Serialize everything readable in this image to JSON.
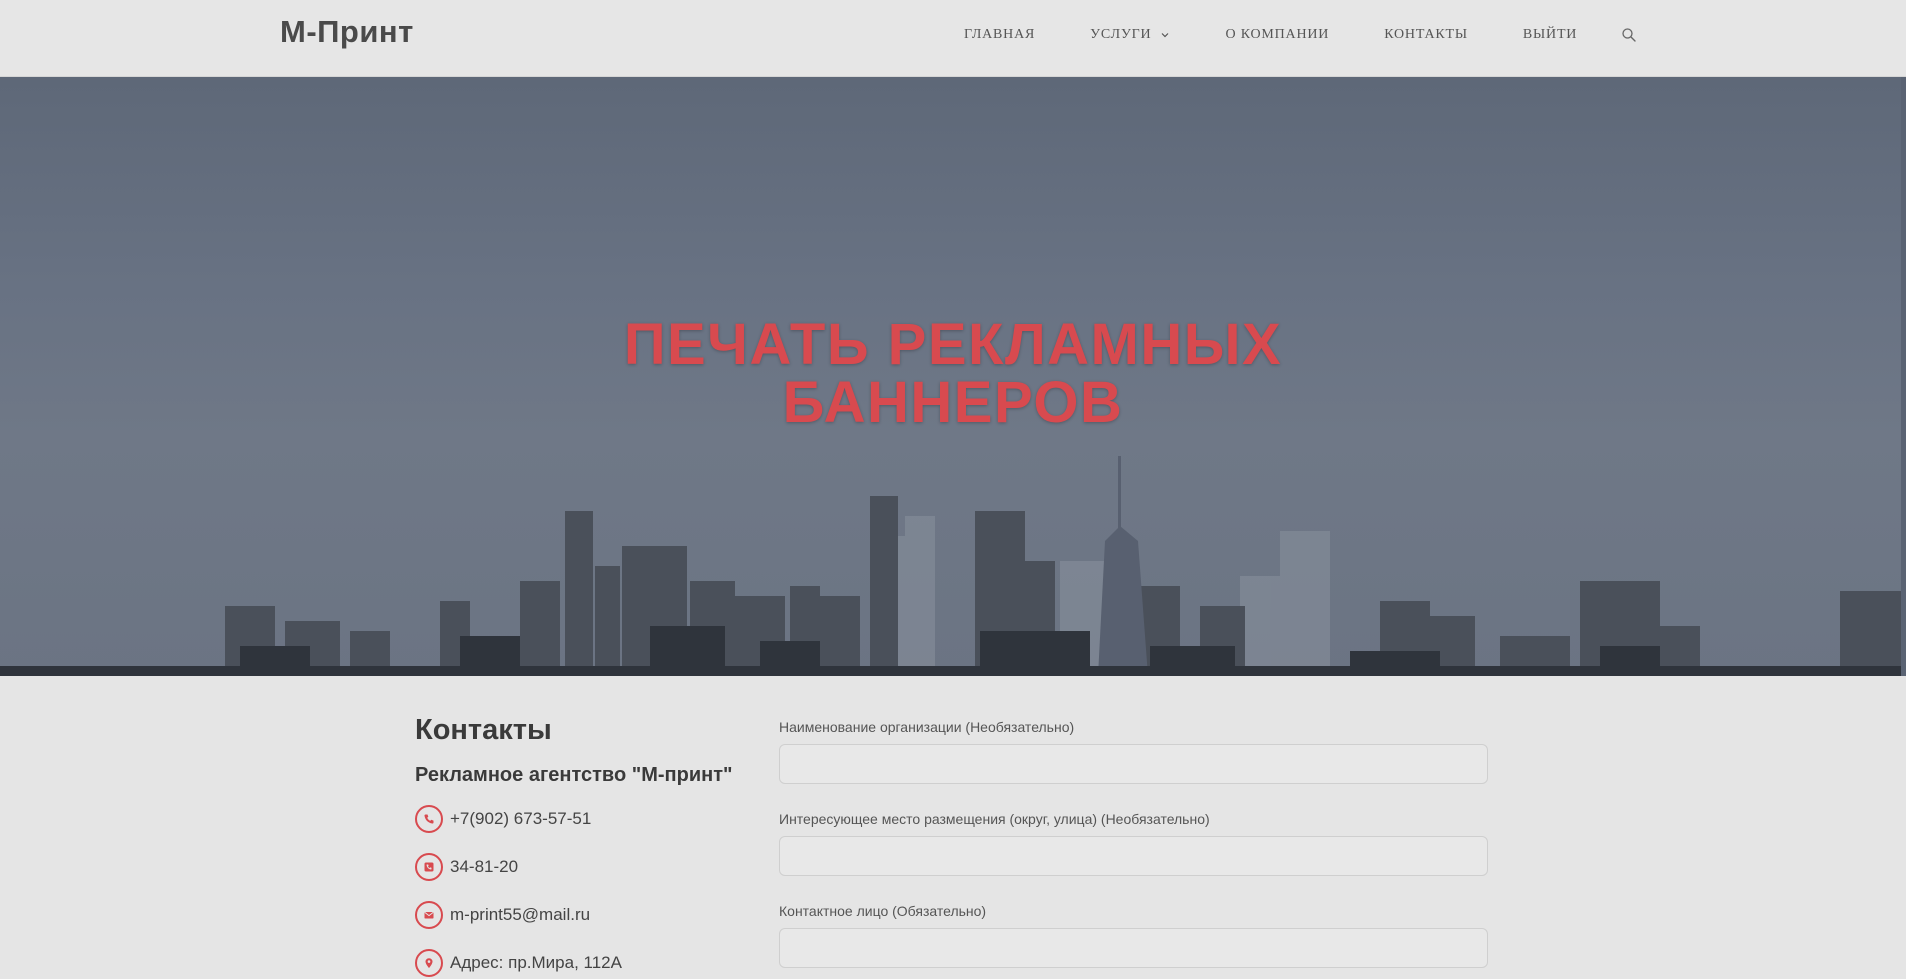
{
  "header": {
    "logo": "М-Принт",
    "nav": [
      {
        "label": "ГЛАВНАЯ"
      },
      {
        "label": "УСЛУГИ",
        "has_dropdown": true
      },
      {
        "label": "О КОМПАНИИ"
      },
      {
        "label": "КОНТАКТЫ"
      },
      {
        "label": "ВЫЙТИ"
      }
    ],
    "search_icon": "search-icon"
  },
  "hero": {
    "title_line1": "ПЕЧАТЬ РЕКЛАМНЫХ",
    "title_line2": "БАННЕРОВ",
    "title_color": "#d84a4f"
  },
  "contacts": {
    "heading": "Контакты",
    "company": "Рекламное агентство \"М-принт\"",
    "items": [
      {
        "icon": "phone-icon",
        "text": "+7(902) 673-57-51"
      },
      {
        "icon": "fax-icon",
        "text": "34-81-20"
      },
      {
        "icon": "envelope-icon",
        "text": "m-print55@mail.ru"
      },
      {
        "icon": "location-pin-icon",
        "text": "Адрес: пр.Мира, 112А"
      }
    ]
  },
  "form": {
    "fields": [
      {
        "label": "Наименование организации (Необязательно)",
        "value": ""
      },
      {
        "label": "Интересующее место размещения (округ, улица) (Необязательно)",
        "value": ""
      },
      {
        "label": "Контактное лицо (Обязательно)",
        "value": ""
      }
    ]
  },
  "colors": {
    "accent": "#d84a4f",
    "page_bg": "#e5e5e5",
    "hero_bg": "#687283"
  }
}
